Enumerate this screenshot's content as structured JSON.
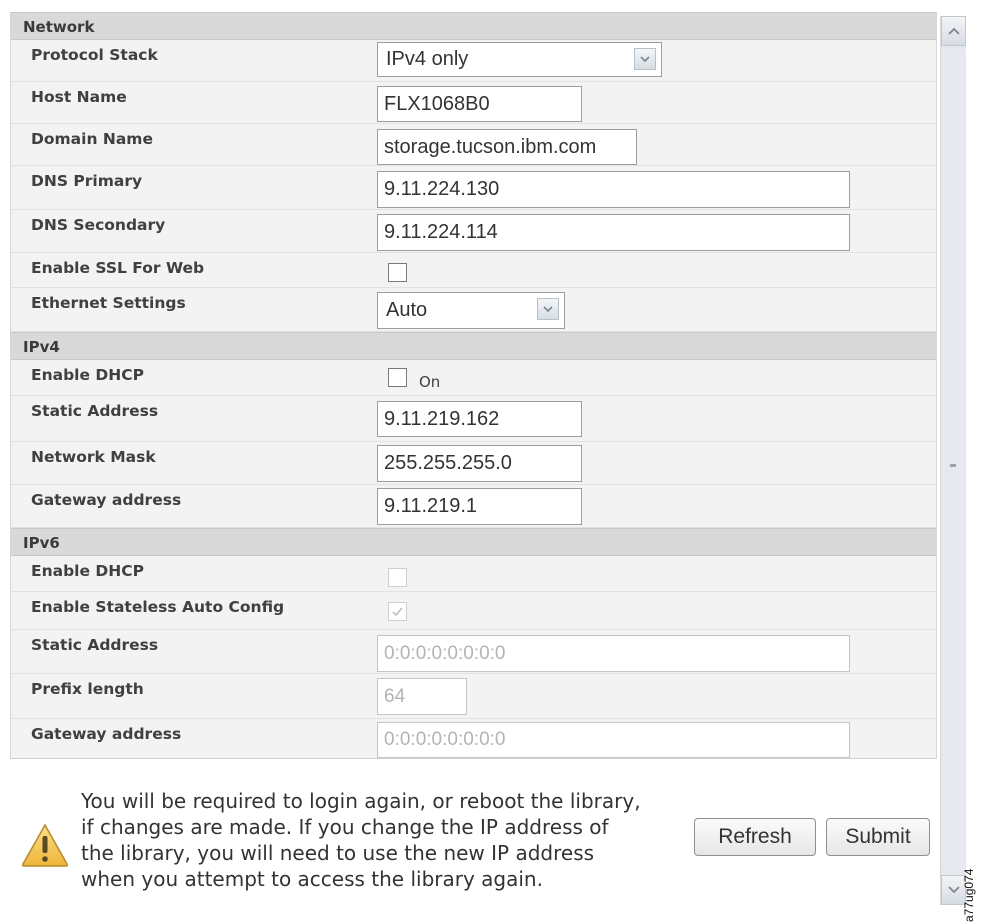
{
  "network": {
    "header": "Network",
    "protocol_stack": {
      "label": "Protocol Stack",
      "value": "IPv4 only"
    },
    "host_name": {
      "label": "Host Name",
      "value": "FLX1068B0"
    },
    "domain_name": {
      "label": "Domain Name",
      "value": "storage.tucson.ibm.com"
    },
    "dns_primary": {
      "label": "DNS Primary",
      "value": "9.11.224.130"
    },
    "dns_secondary": {
      "label": "DNS Secondary",
      "value": "9.11.224.114"
    },
    "enable_ssl": {
      "label": "Enable SSL For Web",
      "checked": false
    },
    "ethernet_settings": {
      "label": "Ethernet Settings",
      "value": "Auto"
    }
  },
  "ipv4": {
    "header": "IPv4",
    "enable_dhcp": {
      "label": "Enable DHCP",
      "checked": false,
      "text": "On"
    },
    "static_address": {
      "label": "Static Address",
      "value": "9.11.219.162"
    },
    "network_mask": {
      "label": "Network Mask",
      "value": "255.255.255.0"
    },
    "gateway": {
      "label": "Gateway address",
      "value": "9.11.219.1"
    }
  },
  "ipv6": {
    "header": "IPv6",
    "enable_dhcp": {
      "label": "Enable DHCP",
      "checked": false,
      "disabled": true
    },
    "stateless_auto_config": {
      "label": "Enable Stateless Auto Config",
      "checked": true,
      "disabled": true
    },
    "static_address": {
      "label": "Static Address",
      "value": "0:0:0:0:0:0:0:0"
    },
    "prefix_length": {
      "label": "Prefix length",
      "value": "64"
    },
    "gateway": {
      "label": "Gateway address",
      "value": "0:0:0:0:0:0:0:0"
    }
  },
  "warning": {
    "icon": "warning-icon",
    "text": "You will be required to login again, or reboot the library, if changes are made. If you change the IP address of the library, you will need to use the new IP address when you attempt to access the library again."
  },
  "buttons": {
    "refresh": "Refresh",
    "submit": "Submit"
  },
  "figure_code": "a77ug074",
  "colors": {
    "section_header_bg": "#d9d9d9",
    "row_bg": "#f3f3f3",
    "input_border": "#9d9d9d",
    "warning_yellow": "#f3c64a"
  }
}
